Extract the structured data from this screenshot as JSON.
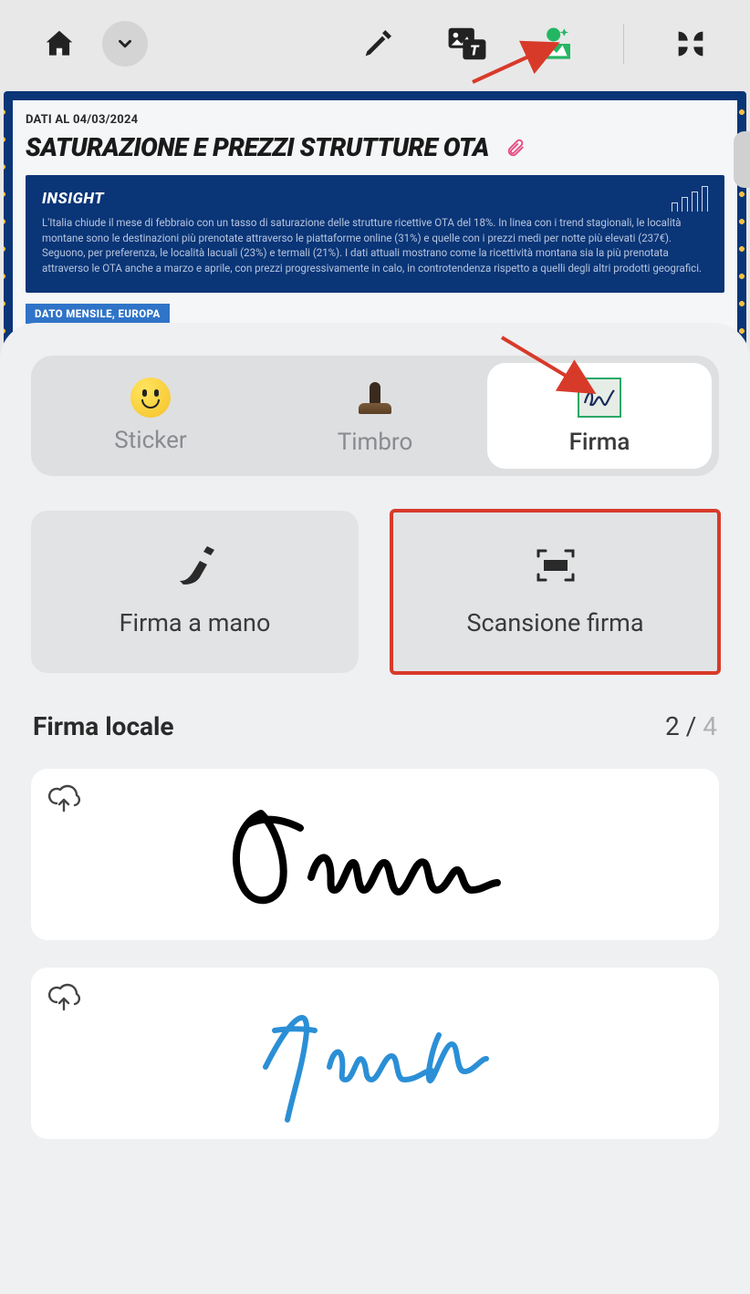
{
  "toolbar": {
    "home_label": "Home",
    "dropdown_label": "More",
    "highlighter_label": "Highlighter",
    "image_tool_label": "Image/Text",
    "sticker_tool_label": "Decorate",
    "apps_label": "Apps"
  },
  "document": {
    "date_prefix": "DATI AL 04/03/2024",
    "title": "SATURAZIONE E PREZZI STRUTTURE OTA",
    "insight_heading": "INSIGHT",
    "insight_body": "L'Italia chiude il mese di febbraio con un tasso di saturazione delle strutture ricettive OTA del 18%. In linea con i trend stagionali, le località montane sono le destinazioni più prenotate attraverso le piattaforme online (31%) e quelle con i prezzi medi per notte più elevati (237€). Seguono, per preferenza, le località lacuali (23%) e termali (21%). I dati attuali mostrano come la ricettività montana sia la più prenotata attraverso le OTA anche a marzo e aprile, con prezzi progressivamente in calo, in controtendenza rispetto a quelli degli altri prodotti geografici.",
    "badge": "DATO MENSILE, EUROPA"
  },
  "sheet": {
    "tabs": [
      {
        "label": "Sticker"
      },
      {
        "label": "Timbro"
      },
      {
        "label": "Firma"
      }
    ],
    "actions": {
      "handwrite": "Firma a mano",
      "scan": "Scansione firma"
    },
    "local_title": "Firma locale",
    "count_current": "2",
    "count_sep": " / ",
    "count_max": "4"
  }
}
